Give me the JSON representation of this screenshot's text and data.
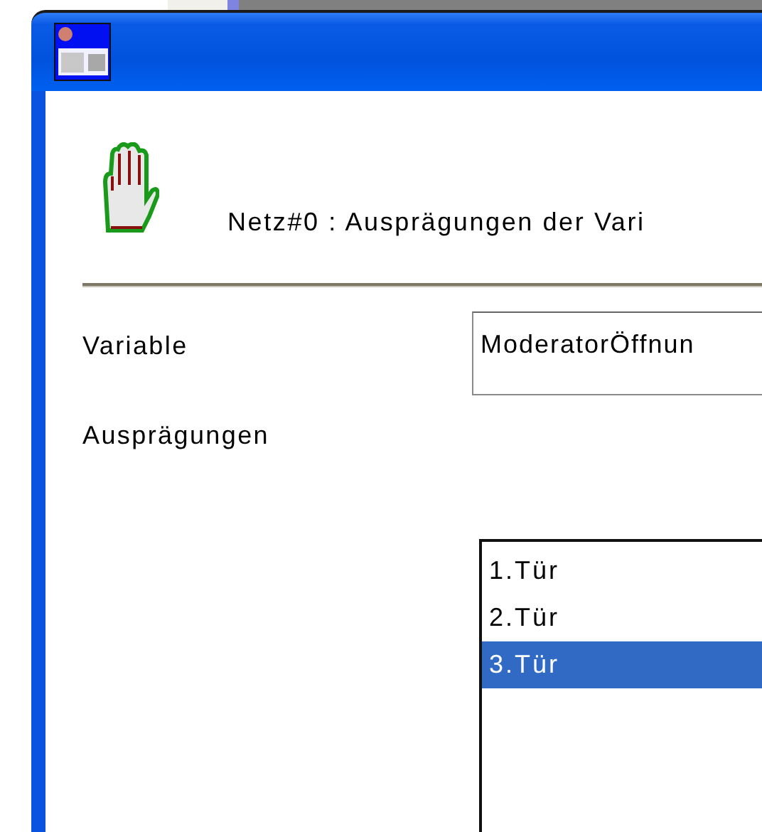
{
  "header": {
    "text": "Netz#0 : Ausprägungen der Vari"
  },
  "variable": {
    "label": "Variable",
    "value": "ModeratorÖffnun"
  },
  "values": {
    "label": "Ausprägungen",
    "items": [
      {
        "text": "1.Tür",
        "selected": false
      },
      {
        "text": "2.Tür",
        "selected": false
      },
      {
        "text": "3.Tür",
        "selected": true
      }
    ]
  }
}
